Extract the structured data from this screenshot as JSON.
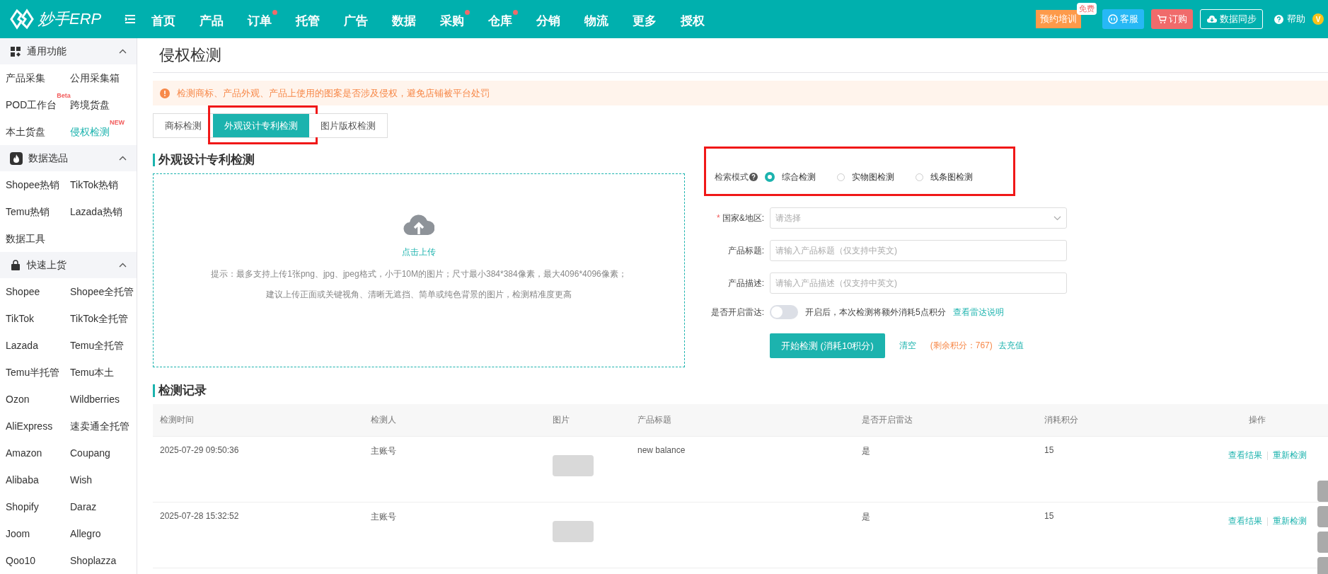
{
  "header": {
    "logo_text": "妙手ERP",
    "nav": [
      {
        "label": "首页",
        "dot": false
      },
      {
        "label": "产品",
        "dot": false
      },
      {
        "label": "订单",
        "dot": true
      },
      {
        "label": "托管",
        "dot": false
      },
      {
        "label": "广告",
        "dot": false
      },
      {
        "label": "数据",
        "dot": false
      },
      {
        "label": "采购",
        "dot": true
      },
      {
        "label": "仓库",
        "dot": true
      },
      {
        "label": "分销",
        "dot": false
      },
      {
        "label": "物流",
        "dot": false
      },
      {
        "label": "更多",
        "dot": false
      },
      {
        "label": "授权",
        "dot": false
      }
    ],
    "training": {
      "label": "预约培训",
      "badge": "免费"
    },
    "service": "客服",
    "order": "订购",
    "sync": "数据同步",
    "help": "帮助",
    "avatar": "V"
  },
  "sidebar": [
    {
      "title": "通用功能",
      "expanded": true,
      "items": [
        {
          "label": "产品采集",
          "selected": false
        },
        {
          "label": "公用采集箱",
          "selected": false
        },
        {
          "label": "POD工作台",
          "selected": false,
          "badge": "Beta"
        },
        {
          "label": "跨境货盘",
          "selected": false
        },
        {
          "label": "本土货盘",
          "selected": false
        },
        {
          "label": "侵权检测",
          "selected": true,
          "badge": "NEW"
        }
      ]
    },
    {
      "title": "数据选品",
      "expanded": true,
      "items": [
        {
          "label": "Shopee热销",
          "selected": false
        },
        {
          "label": "TikTok热销",
          "selected": false
        },
        {
          "label": "Temu热销",
          "selected": false
        },
        {
          "label": "Lazada热销",
          "selected": false
        },
        {
          "label": "数据工具",
          "selected": false
        }
      ]
    },
    {
      "title": "快速上货",
      "expanded": true,
      "items": [
        {
          "label": "Shopee",
          "selected": false
        },
        {
          "label": "Shopee全托管",
          "selected": false
        },
        {
          "label": "TikTok",
          "selected": false
        },
        {
          "label": "TikTok全托管",
          "selected": false
        },
        {
          "label": "Lazada",
          "selected": false
        },
        {
          "label": "Temu全托管",
          "selected": false
        },
        {
          "label": "Temu半托管",
          "selected": false
        },
        {
          "label": "Temu本土",
          "selected": false
        },
        {
          "label": "Ozon",
          "selected": false
        },
        {
          "label": "Wildberries",
          "selected": false
        },
        {
          "label": "AliExpress",
          "selected": false
        },
        {
          "label": "速卖通全托管",
          "selected": false
        },
        {
          "label": "Amazon",
          "selected": false
        },
        {
          "label": "Coupang",
          "selected": false
        },
        {
          "label": "Alibaba",
          "selected": false
        },
        {
          "label": "Wish",
          "selected": false
        },
        {
          "label": "Shopify",
          "selected": false
        },
        {
          "label": "Daraz",
          "selected": false
        },
        {
          "label": "Joom",
          "selected": false
        },
        {
          "label": "Allegro",
          "selected": false
        },
        {
          "label": "Qoo10",
          "selected": false
        },
        {
          "label": "Shoplazza",
          "selected": false
        }
      ]
    }
  ],
  "page_title": "侵权检测",
  "alert": "检测商标、产品外观、产品上使用的图案是否涉及侵权，避免店铺被平台处罚",
  "tabs": [
    {
      "label": "商标检测",
      "selected": false
    },
    {
      "label": "外观设计专利检测",
      "selected": true
    },
    {
      "label": "图片版权检测",
      "selected": false
    }
  ],
  "section_title": "外观设计专利检测",
  "upload": {
    "link": "点击上传",
    "hints": [
      "提示：最多支持上传1张png、jpg、jpeg格式，小于10M的图片；尺寸最小384*384像素，最大4096*4096像素；",
      "建议上传正面或关键视角、清晰无遮挡、简单或纯色背景的图片，检测精准度更高"
    ]
  },
  "mode": {
    "label": "检索模式",
    "options": [
      {
        "label": "综合检测",
        "selected": true
      },
      {
        "label": "实物图检测",
        "selected": false
      },
      {
        "label": "线条图检测",
        "selected": false
      }
    ]
  },
  "required_mark": "*",
  "fields": [
    {
      "kind": "select",
      "label": "国家&地区:",
      "required": true,
      "placeholder": "请选择"
    },
    {
      "kind": "input",
      "label": "产品标题:",
      "required": false,
      "placeholder": "请输入产品标题（仅支持中英文)"
    },
    {
      "kind": "input",
      "label": "产品描述:",
      "required": false,
      "placeholder": "请输入产品描述（仅支持中英文)"
    }
  ],
  "radar": {
    "label": "是否开启雷达:",
    "on": false,
    "note": "开启后，本次检测将额外消耗5点积分",
    "link": "查看雷达说明"
  },
  "actions": {
    "submit": "开始检测 (消耗10积分)",
    "clear": "清空",
    "credits": "(剩余积分：767)",
    "recharge": "去充值"
  },
  "records_title": "检测记录",
  "table": {
    "columns": [
      "检测时间",
      "检测人",
      "图片",
      "产品标题",
      "是否开启雷达",
      "消耗积分",
      "操作"
    ],
    "rows": [
      {
        "time": "2025-07-29 09:50:36",
        "user": "主账号",
        "title": "new balance",
        "radar": "是",
        "credits": "15",
        "actions": [
          "查看结果",
          "重新检测"
        ]
      },
      {
        "time": "2025-07-28 15:32:52",
        "user": "主账号",
        "title": "",
        "radar": "是",
        "credits": "15",
        "actions": [
          "查看结果",
          "重新检测"
        ]
      }
    ]
  }
}
